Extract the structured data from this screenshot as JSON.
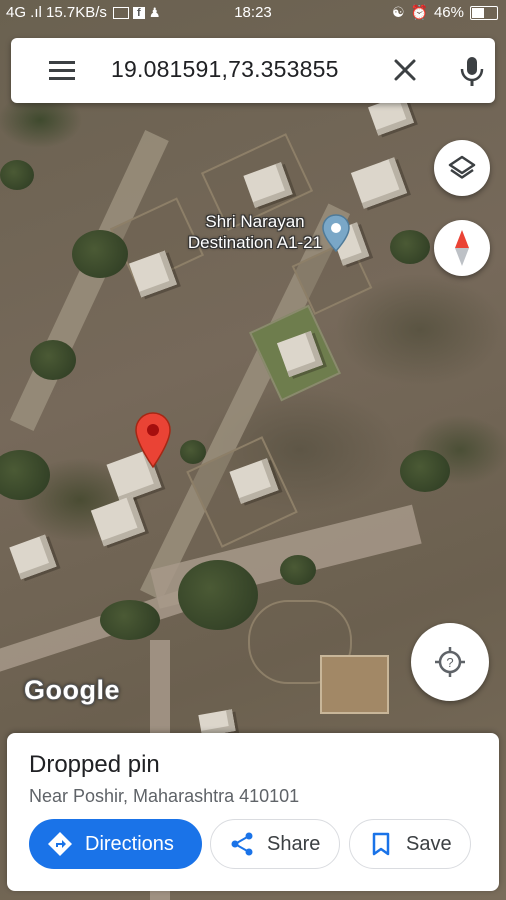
{
  "status_bar": {
    "left": "4G .ıl 15.7KB/s",
    "time": "18:23",
    "battery": "46%",
    "battery_level": 0.46
  },
  "search": {
    "query": "19.081591,73.353855"
  },
  "map": {
    "place_label": "Shri Narayan Destination A1-21",
    "attribution": "Google"
  },
  "place": {
    "title": "Dropped pin",
    "address": "Near Poshir, Maharashtra 410101"
  },
  "actions": {
    "directions": "Directions",
    "share": "Share",
    "save": "Save"
  },
  "colors": {
    "accent": "#1a73e8",
    "pin": "#ea4335",
    "place_marker": "#7aa7c7"
  },
  "icons": {
    "menu": "menu-icon",
    "close": "close-icon",
    "mic": "mic-icon",
    "layers": "layers-icon",
    "compass": "compass-icon",
    "locate": "my-location-icon",
    "directions": "directions-icon",
    "share": "share-icon",
    "save": "bookmark-icon"
  }
}
